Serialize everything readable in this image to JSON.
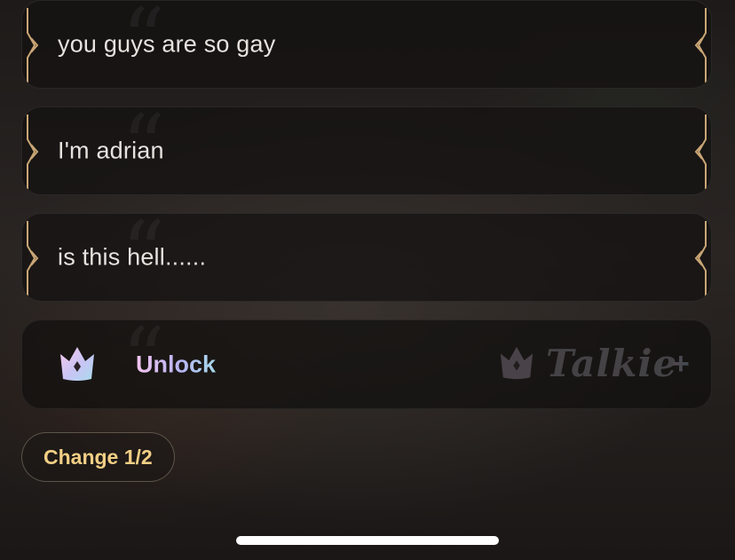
{
  "options": [
    {
      "text": "you guys are so gay"
    },
    {
      "text": "I'm adrian"
    },
    {
      "text": "is this hell......"
    }
  ],
  "unlock": {
    "label": "Unlock",
    "brand_text": "Talkie",
    "brand_plus": "+"
  },
  "change": {
    "label": "Change 1/2"
  },
  "icons": {
    "quote": "quote-icon",
    "frame": "ornate-frame-icon",
    "crown": "crown-icon"
  },
  "colors": {
    "frame_gold": "#c9a675",
    "change_text": "#f2cf85",
    "unlock_gradient_start": "#f3c4ef",
    "unlock_gradient_end": "#a6d7ea"
  }
}
